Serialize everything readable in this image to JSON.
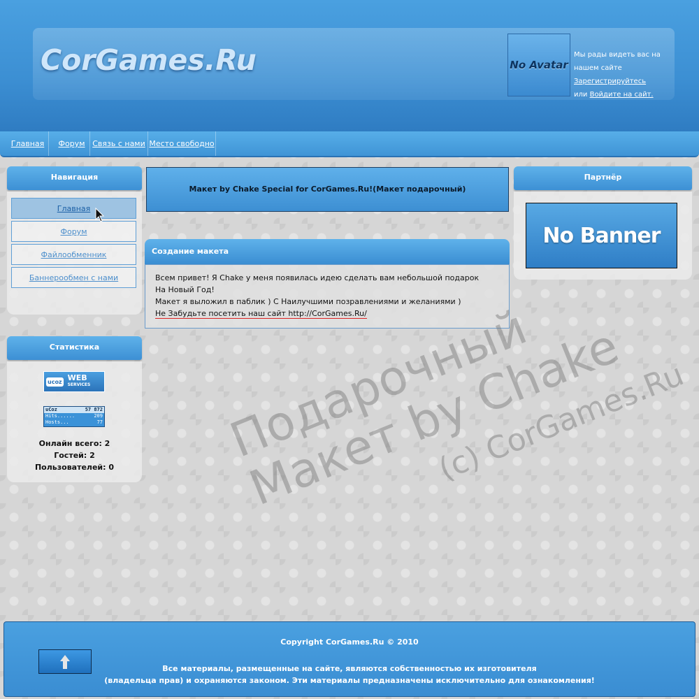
{
  "header": {
    "logo_text": "CorGames.Ru",
    "avatar_text": "No Avatar",
    "welcome_prefix": "Мы рады видеть вас на нашем сайте",
    "register_link": "Зарегистрируйтесь",
    "or_text": "или",
    "login_link": "Войдите на сайт."
  },
  "nav": {
    "items": [
      {
        "label": "Главная"
      },
      {
        "label": "Форум"
      },
      {
        "label": "Связь с нами"
      },
      {
        "label": "Место свободно"
      }
    ]
  },
  "sidebar_nav": {
    "title": "Навигация",
    "items": [
      {
        "label": "Главная"
      },
      {
        "label": "Форум"
      },
      {
        "label": "Файлообменник"
      },
      {
        "label": "Баннерообмен с нами"
      }
    ]
  },
  "stats": {
    "title": "Статистика",
    "ucoz_web": {
      "logo": "ucoz",
      "line1": "WEB",
      "line2": "SERVICES"
    },
    "counter": {
      "brand": "uCoz",
      "total": "57 872",
      "hits_label": "Hits......",
      "hits": "209",
      "hosts_label": "Hosts...",
      "hosts": "77"
    },
    "online_total": "Онлайн всего: 2",
    "guests": "Гостей: 2",
    "users": "Пользователей: 0"
  },
  "announce": "Макет by Chake Special for CorGames.Ru!(Макет подарочный)",
  "post": {
    "title": "Создание макета",
    "line1": "Всем привет! Я Chake у меня появилась идею сделать вам небольшой подарок",
    "line2": "На Новый Год!",
    "line3": "Макет я выложил в паблик ) С Наилучшими позравлениями и желаниями )",
    "line4": "Не Забудьте посетить наш сайт http://CorGames.Ru/"
  },
  "partner": {
    "title": "Партнёр",
    "banner_text": "No Banner"
  },
  "watermark": {
    "line1": "Подарочный",
    "line2": "Макет by Chake",
    "line3": "(c) CorGames.Ru"
  },
  "footer": {
    "copyright": "Copyright CorGames.Ru © 2010",
    "rights_line1": "Все материалы, размещенные на сайте, являются собственностью их изготовителя",
    "rights_line2": "(владельца прав) и охраняются законом. Эти материалы предназначены исключительно для ознакомления!"
  }
}
